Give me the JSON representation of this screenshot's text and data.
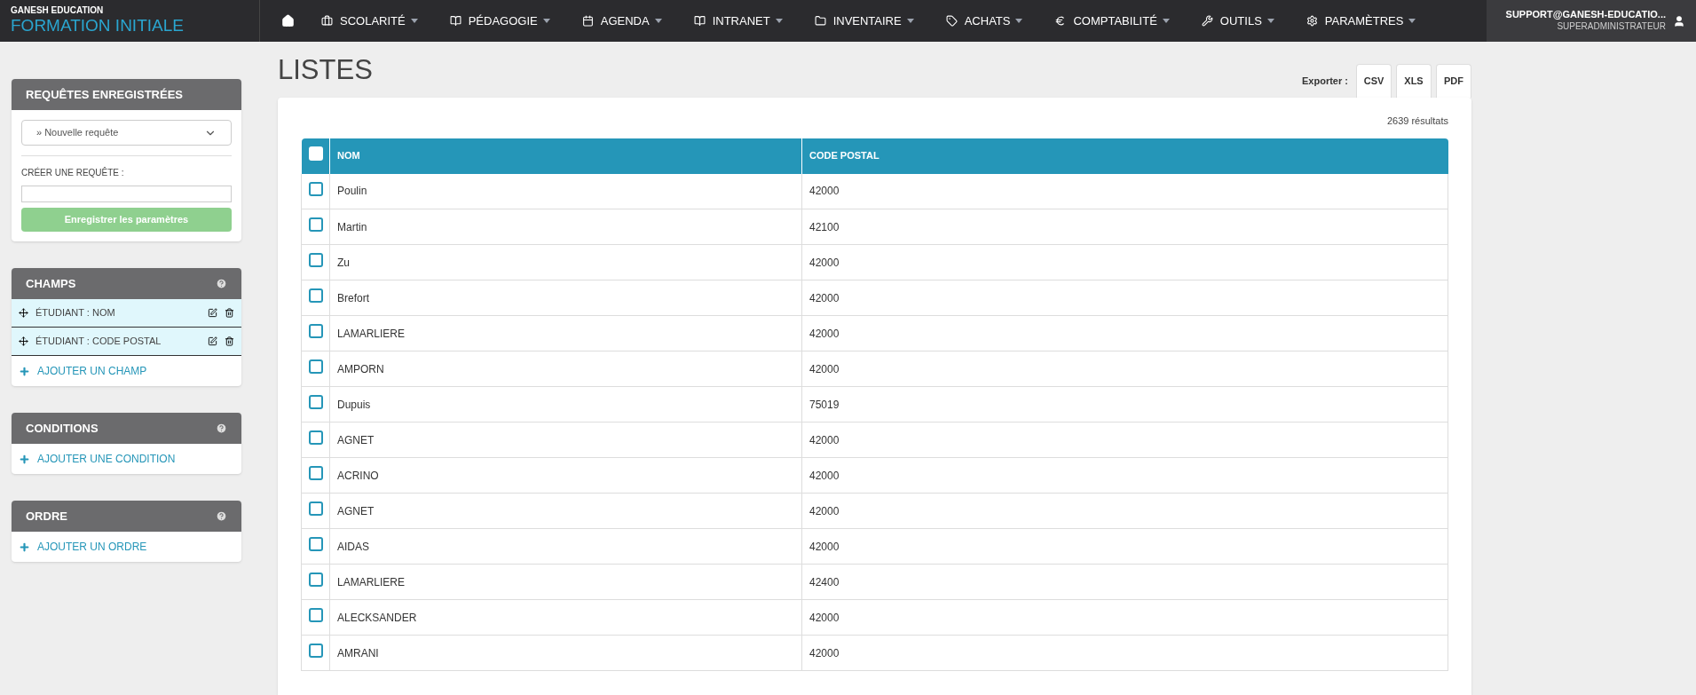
{
  "brand": {
    "company": "GANESH EDUCATION",
    "product": "FORMATION INITIALE"
  },
  "nav": [
    {
      "kind": "home"
    },
    {
      "kind": "menu",
      "label": "SCOLARITÉ"
    },
    {
      "kind": "menu",
      "label": "PÉDAGOGIE"
    },
    {
      "kind": "menu",
      "label": "AGENDA"
    },
    {
      "kind": "menu",
      "label": "INTRANET"
    },
    {
      "kind": "menu",
      "label": "INVENTAIRE"
    },
    {
      "kind": "menu",
      "label": "ACHATS"
    },
    {
      "kind": "menu",
      "label": "COMPTABILITÉ"
    },
    {
      "kind": "menu",
      "label": "OUTILS"
    },
    {
      "kind": "menu",
      "label": "PARAMÈTRES"
    }
  ],
  "user": {
    "email": "SUPPORT@GANESH-EDUCATIO...",
    "role": "SUPERADMINISTRATEUR"
  },
  "saved_queries": {
    "title": "REQUÊTES ENREGISTRÉES",
    "select_value": "» Nouvelle requête",
    "create_label": "CRÉER UNE REQUÊTE :",
    "save_button": "Enregistrer les paramètres"
  },
  "panels": [
    {
      "title": "CHAMPS",
      "items": [
        "ÉTUDIANT : NOM",
        "ÉTUDIANT : CODE POSTAL"
      ],
      "add": "AJOUTER UN CHAMP"
    },
    {
      "title": "CONDITIONS",
      "add": "AJOUTER UNE CONDITION"
    },
    {
      "title": "ORDRE",
      "add": "AJOUTER UN ORDRE"
    }
  ],
  "page_title": "LISTES",
  "export": {
    "label": "Exporter :",
    "buttons": [
      "CSV",
      "XLS",
      "PDF"
    ]
  },
  "results": "2639 résultats",
  "table": {
    "all_checked": false,
    "columns": [
      "NOM",
      "CODE POSTAL"
    ],
    "rows": [
      {
        "checked": false,
        "cells": [
          "Poulin",
          "42000"
        ]
      },
      {
        "checked": false,
        "cells": [
          "Martin",
          "42100"
        ]
      },
      {
        "checked": false,
        "cells": [
          "Zu",
          "42000"
        ]
      },
      {
        "checked": false,
        "cells": [
          "Brefort",
          "42000"
        ]
      },
      {
        "checked": false,
        "cells": [
          "LAMARLIERE",
          "42000"
        ]
      },
      {
        "checked": false,
        "cells": [
          "AMPORN",
          "42000"
        ]
      },
      {
        "checked": false,
        "cells": [
          "Dupuis",
          "75019"
        ]
      },
      {
        "checked": false,
        "cells": [
          "AGNET",
          "42000"
        ]
      },
      {
        "checked": false,
        "cells": [
          "ACRINO",
          "42000"
        ]
      },
      {
        "checked": false,
        "cells": [
          "AGNET",
          "42000"
        ]
      },
      {
        "checked": false,
        "cells": [
          "AIDAS",
          "42000"
        ]
      },
      {
        "checked": false,
        "cells": [
          "LAMARLIERE",
          "42400"
        ]
      },
      {
        "checked": false,
        "cells": [
          "ALECKSANDER",
          "42000"
        ]
      },
      {
        "checked": false,
        "cells": [
          "AMRANI",
          "42000"
        ]
      }
    ]
  }
}
